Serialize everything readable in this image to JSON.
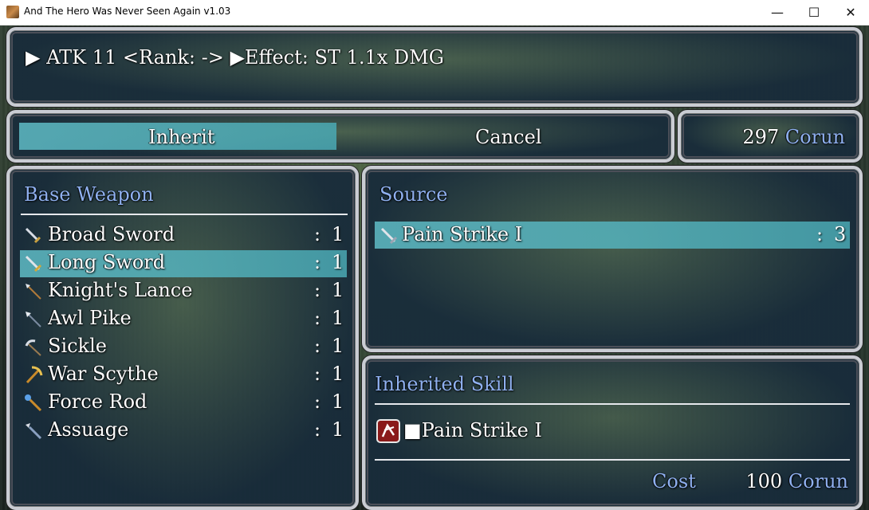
{
  "window": {
    "title": "And The Hero Was Never Seen Again v1.03",
    "minimize": "—",
    "maximize": "☐",
    "close": "✕"
  },
  "info": {
    "text": "▶ ATK 11 <Rank: -> ▶Effect: ST 1.1x DMG"
  },
  "commands": {
    "inherit": "Inherit",
    "cancel": "Cancel"
  },
  "money": {
    "amount": "297",
    "currency": "Corun"
  },
  "base_weapon": {
    "heading": "Base Weapon",
    "items": [
      {
        "name": "Broad Sword",
        "sep": ":",
        "qty": "1",
        "icon": "sword-icon"
      },
      {
        "name": "Long Sword",
        "sep": ":",
        "qty": "1",
        "icon": "sword-icon"
      },
      {
        "name": "Knight's Lance",
        "sep": ":",
        "qty": "1",
        "icon": "lance-icon"
      },
      {
        "name": "Awl Pike",
        "sep": ":",
        "qty": "1",
        "icon": "pike-icon"
      },
      {
        "name": "Sickle",
        "sep": ":",
        "qty": "1",
        "icon": "sickle-icon"
      },
      {
        "name": "War Scythe",
        "sep": ":",
        "qty": "1",
        "icon": "scythe-icon"
      },
      {
        "name": "Force Rod",
        "sep": ":",
        "qty": "1",
        "icon": "rod-icon"
      },
      {
        "name": "Assuage",
        "sep": ":",
        "qty": "1",
        "icon": "staff-icon"
      }
    ]
  },
  "source": {
    "heading": "Source",
    "items": [
      {
        "name": "Pain Strike I",
        "sep": ":",
        "qty": "3",
        "icon": "sword-icon"
      }
    ]
  },
  "inherited": {
    "heading": "Inherited Skill",
    "skill": "■Pain Strike I",
    "cost_label": "Cost",
    "cost_amount": "100",
    "cost_currency": "Corun"
  },
  "colors": {
    "selection": "#5fbcc6",
    "system_blue": "#8fb0f0"
  }
}
